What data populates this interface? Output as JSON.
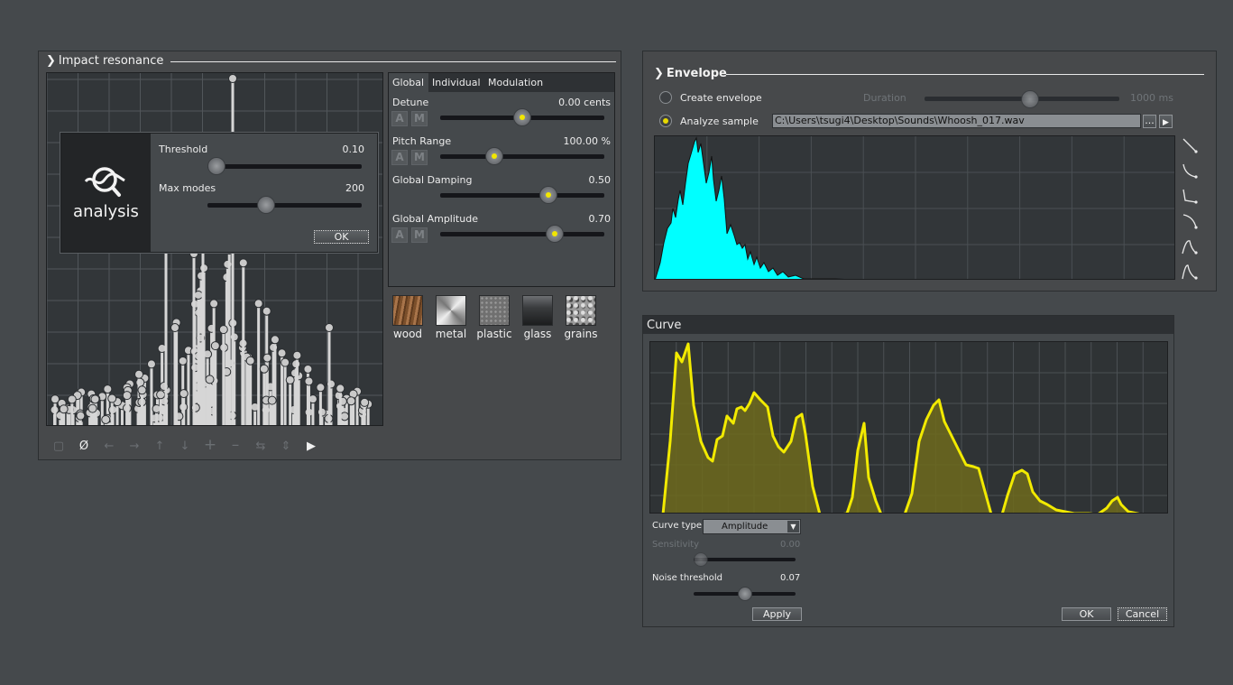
{
  "impact": {
    "title": "Impact resonance",
    "tabs": [
      "Global",
      "Individual",
      "Modulation"
    ],
    "params": [
      {
        "label": "Detune",
        "value": "0.00 cents",
        "level": 0.5,
        "am": true
      },
      {
        "label": "Pitch Range",
        "value": "100.00 %",
        "level": 0.33,
        "am": true
      },
      {
        "label": "Global Damping",
        "value": "0.50",
        "level": 0.66,
        "am": false
      },
      {
        "label": "Global Amplitude",
        "value": "0.70",
        "level": 0.7,
        "am": true
      }
    ],
    "am_a": "A",
    "am_m": "M",
    "materials": [
      {
        "label": "wood",
        "icon": "wood-texture-icon"
      },
      {
        "label": "metal",
        "icon": "metal-texture-icon"
      },
      {
        "label": "plastic",
        "icon": "plastic-texture-icon"
      },
      {
        "label": "glass",
        "icon": "glass-texture-icon"
      },
      {
        "label": "grains",
        "icon": "grains-texture-icon"
      }
    ],
    "toolbar": [
      "edit-icon",
      "no-selection-icon",
      "arrow-left-icon",
      "arrow-right-icon",
      "arrow-up-icon",
      "arrow-down-icon",
      "plus-icon",
      "minus-icon",
      "spread-icon",
      "distribute-icon",
      "play-icon"
    ]
  },
  "analysis": {
    "logo_text": "analysis",
    "threshold_label": "Threshold",
    "threshold_value": "0.10",
    "threshold_level": 0.06,
    "maxmodes_label": "Max modes",
    "maxmodes_value": "200",
    "maxmodes_level": 0.38,
    "ok_label": "OK"
  },
  "envelope": {
    "title": "Envelope",
    "create_label": "Create envelope",
    "duration_label": "Duration",
    "duration_value": "1000 ms",
    "duration_level": 0.54,
    "analyze_label": "Analyze sample",
    "file_path": "C:\\Users\\tsugi4\\Desktop\\Sounds\\Whoosh_017.wav",
    "browse_label": "...",
    "fill_color": "#00ffff"
  },
  "curve": {
    "title": "Curve",
    "curve_type_label": "Curve type",
    "curve_type_value": "Amplitude",
    "sensitivity_label": "Sensitivity",
    "sensitivity_value": "0.00",
    "sensitivity_level": 0.0,
    "noise_label": "Noise threshold",
    "noise_value": "0.07",
    "noise_level": 0.43,
    "apply_label": "Apply",
    "ok_label": "OK",
    "cancel_label": "Cancel",
    "line_color": "#f2ea00"
  }
}
